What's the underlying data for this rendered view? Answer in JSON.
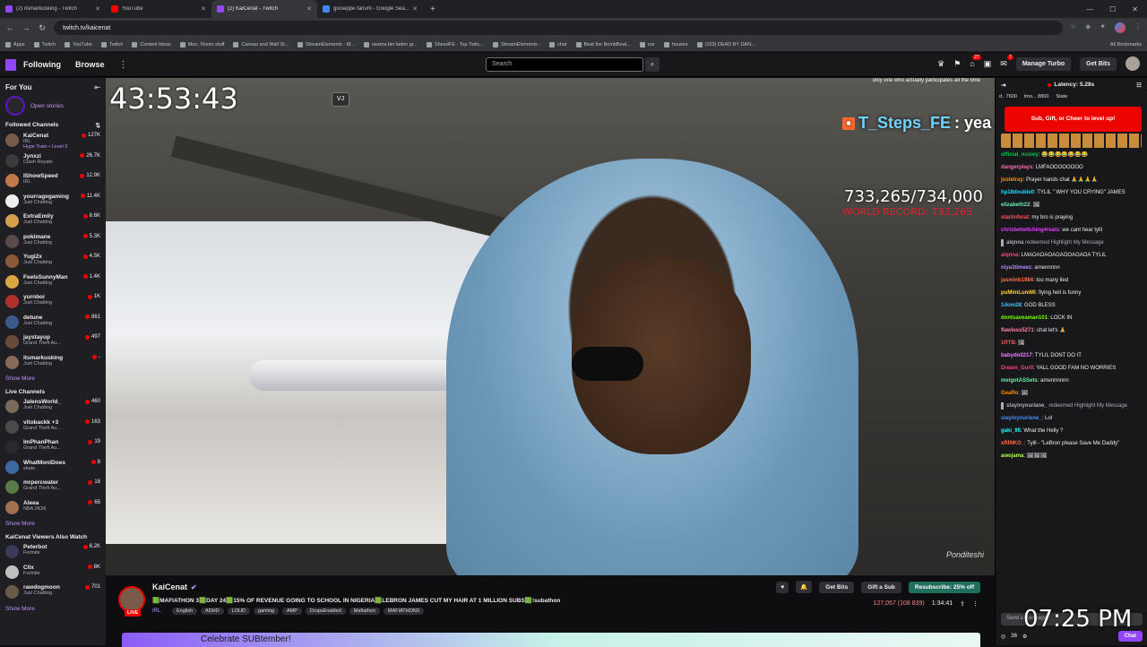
{
  "browser": {
    "tabs": [
      {
        "title": "(2) itsmarkusking - Twitch",
        "color": "#9146ff",
        "active": false
      },
      {
        "title": "YouTube",
        "color": "#ff0000",
        "active": false
      },
      {
        "title": "(2) KaiCenat - Twitch",
        "color": "#9146ff",
        "active": true
      },
      {
        "title": "giuseppe fanum - Google Sea...",
        "color": "#4285f4",
        "active": false
      }
    ],
    "url": "twitch.tv/kaicenat",
    "bookmarks": [
      "Apps",
      "Twitch",
      "YouTube",
      "Twitch",
      "Content Ideas",
      "Misc. Room stuff",
      "Canvas and Wall St...",
      "StreamElements - M...",
      "osama bin laden gr...",
      "SheedFE - Top Twitc...",
      "StreamElements -",
      "chat",
      "Beat the BombBeat...",
      "oor",
      "houses",
      "(103) DEAD BY DAN..."
    ],
    "all_bookmarks": "All Bookmarks"
  },
  "topnav": {
    "following": "Following",
    "browse": "Browse",
    "search_placeholder": "Search",
    "notif_count_1": "27",
    "notif_count_2": "7",
    "manage_turbo": "Manage Turbo",
    "get_bits": "Get Bits"
  },
  "sidebar": {
    "for_you": "For You",
    "open_stories": "Open stories",
    "followed_title": "Followed Channels",
    "followed": [
      {
        "name": "KaiCenat",
        "game": "IRL",
        "viewers": "127K",
        "hype": "Hype Train • Level 3",
        "color": "#7a5a48"
      },
      {
        "name": "Jynxzi",
        "game": "Clash Royale",
        "viewers": "26.7K",
        "color": "#3a3a3a"
      },
      {
        "name": "IShowSpeed",
        "game": "IRL",
        "viewers": "12.9K",
        "color": "#c07a4a"
      },
      {
        "name": "yourragegaming",
        "game": "Just Chatting",
        "viewers": "11.4K",
        "color": "#eeeeee"
      },
      {
        "name": "ExtraEmily",
        "game": "Just Chatting",
        "viewers": "8.6K",
        "color": "#d4a04a"
      },
      {
        "name": "pokimane",
        "game": "Just Chatting",
        "viewers": "5.3K",
        "color": "#5a4a4a"
      },
      {
        "name": "Yugi2x",
        "game": "Just Chatting",
        "viewers": "4.5K",
        "color": "#8a5a3a"
      },
      {
        "name": "FeelsSunnyMan",
        "game": "Just Chatting",
        "viewers": "1.4K",
        "color": "#d9a640"
      },
      {
        "name": "yurnboi",
        "game": "Just Chatting",
        "viewers": "1K",
        "color": "#b03030"
      },
      {
        "name": "detune",
        "game": "Just Chatting",
        "viewers": "861",
        "color": "#3a5a8a"
      },
      {
        "name": "jaystayup",
        "game": "Grand Theft Au...",
        "viewers": "497",
        "color": "#6a4a3a"
      },
      {
        "name": "itsmarkusking",
        "game": "Just Chatting",
        "viewers": "-",
        "color": "#8a6a5a"
      }
    ],
    "show_more_1": "Show More",
    "live_title": "Live Channels",
    "live": [
      {
        "name": "JalensWorld_",
        "game": "Just Chatting",
        "viewers": "460",
        "color": "#7a6a5a"
      },
      {
        "name": "vitobackk +3",
        "game": "Grand Theft Au...",
        "viewers": "163",
        "color": "#4a4a4a"
      },
      {
        "name": "ImPhanPhan",
        "game": "Grand Theft Au...",
        "viewers": "19",
        "color": "#2a2a2a"
      },
      {
        "name": "WhatMoniDoes",
        "game": "skate.",
        "viewers": "8",
        "color": "#3a6aa0"
      },
      {
        "name": "mrpercwater",
        "game": "Grand Theft Au...",
        "viewers": "18",
        "color": "#5a7a4a"
      },
      {
        "name": "Aleea",
        "game": "NBA 2K26",
        "viewers": "65",
        "color": "#a07050"
      }
    ],
    "show_more_2": "Show More",
    "also_title": "KaiCenat Viewers Also Watch",
    "also": [
      {
        "name": "Peterbot",
        "game": "Fortnite",
        "viewers": "6.2K",
        "color": "#3a3a5a"
      },
      {
        "name": "Clix",
        "game": "Fortnite",
        "viewers": "8K",
        "color": "#c0c0c0"
      },
      {
        "name": "rawdogmoon",
        "game": "Just Chatting",
        "viewers": "701",
        "color": "#6a5a4a"
      }
    ],
    "show_more_3": "Show More"
  },
  "video": {
    "timer": "43:53:43",
    "vj": "VJ",
    "top_note": "only one who actually participates all the time",
    "tts_user": "T_Steps_FE",
    "tts_text": ": yea",
    "sub_count": "733,265/734,000",
    "record": "WORLD RECORD: 733,265",
    "watermark": "Ponditeshi"
  },
  "channel": {
    "name": "KaiCenat",
    "live": "LIVE",
    "title": "🟩MAFIATHON 3🟩DAY 24🟩15% OF REVENUE GOING TO SCHOOL IN NIGERIA🟩LEBRON JAMES CUT MY HAIR AT 1 MILLION SUBS🟩!subathon",
    "category": "IRL",
    "tags": [
      "English",
      "ADHD",
      "LOUD",
      "gaming",
      "AMP",
      "DropsEnabled",
      "Mafiathon",
      "MAFIATHON3"
    ],
    "get_bits": "Get Bits",
    "gift_sub": "Gift a Sub",
    "resubscribe": "Resubscribe: 25% off",
    "viewers": "127,057 (108 839)",
    "uptime": "1:34:41",
    "banner": "Celebrate SUBtember!"
  },
  "chat": {
    "latency": "Latency: 5.28s",
    "leaders": [
      "d.. 7600",
      "tmo... 8800",
      "State"
    ],
    "cheer": "Sub, Gift, or Cheer to level up!",
    "messages": [
      {
        "user": "official_noxiey",
        "text": ": 😂😂😂😂😂😂😂",
        "color": "#00c853"
      },
      {
        "user": "dangerplays",
        "text": ": LMFAOOOOOOOO",
        "color": "#ff69b4"
      },
      {
        "user": "justelray",
        "text": ": Prayer hands chat 🙏🙏🙏🙏",
        "color": "#ff9800"
      },
      {
        "user": "hp18double0",
        "text": ": TYLIL \" WHY YOU CRYING\" JAMES",
        "color": "#00e5ff"
      },
      {
        "user": "elizabeth22",
        "text": ": 🖼",
        "color": "#69f0ae"
      },
      {
        "user": "starlinferat",
        "text": ": my bro is praying",
        "color": "#ff5252"
      },
      {
        "user": "chrisbetwitching4reals",
        "text": ": we cant hear tylil",
        "color": "#e040fb"
      },
      {
        "user": "alqnna",
        "text": " redeemed Highlight My Message",
        "color": "#adadb8",
        "hl": true
      },
      {
        "user": "alqnna",
        "text": ": LMAOAOAOAOAOOAOAOA TYLIL",
        "color": "#ff4081"
      },
      {
        "user": "niya3timeez",
        "text": ": amennnnn",
        "color": "#b388ff"
      },
      {
        "user": "jasminb1984",
        "text": ": too many lied",
        "color": "#ff6e40"
      },
      {
        "user": "puMimLumMi",
        "text": ": flying heli is funny",
        "color": "#ffd740"
      },
      {
        "user": "1dom28",
        "text": ": GOD BLESS",
        "color": "#40c4ff"
      },
      {
        "user": "dontsaveaman101",
        "text": ": LOCK IN",
        "color": "#76ff03"
      },
      {
        "user": "flawless5271",
        "text": ": chat let's 🙏",
        "color": "#ff80ab"
      },
      {
        "user": "1RTB",
        "text": ": 🖼",
        "color": "#ff5252"
      },
      {
        "user": "babydoll217",
        "text": ": TYLIL DONT DO IT",
        "color": "#ea80fc"
      },
      {
        "user": "Dream_Gurll",
        "text": ": YALL GOOD FAM NO WORRIES",
        "color": "#ff4081"
      },
      {
        "user": "meigotASSets",
        "text": ": amennnnnn",
        "color": "#69f0ae"
      },
      {
        "user": "GeaRo",
        "text": ": 🖼",
        "color": "#ff9100"
      },
      {
        "user": "stayinyourlane_",
        "text": " redeemed Highlight My Message",
        "color": "#adadb8",
        "hl": true
      },
      {
        "user": "stayinyourlane_",
        "text": ": Lol",
        "color": "#448aff"
      },
      {
        "user": "gaki_95",
        "text": ": What the Helly ?",
        "color": "#18ffff"
      },
      {
        "user": "xRINKO_",
        "text": ": Tylil - \"LeBron please Save Me Daddy\"",
        "color": "#ff6e40"
      },
      {
        "user": "awojama",
        "text": ": 🖼🖼🖼",
        "color": "#b2ff59"
      }
    ],
    "input_placeholder": "Send a message",
    "points": "36",
    "chat_button": "Chat",
    "clock": "07:25 PM"
  }
}
